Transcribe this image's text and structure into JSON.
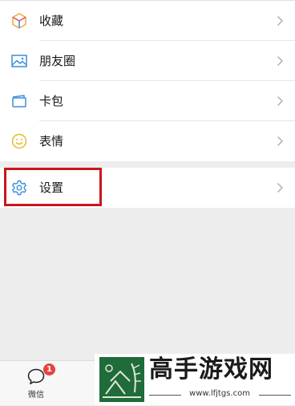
{
  "menu": {
    "items": [
      {
        "label": "收藏",
        "icon": "favorites-cube-icon"
      },
      {
        "label": "朋友圈",
        "icon": "moments-picture-icon"
      },
      {
        "label": "卡包",
        "icon": "card-wallet-icon"
      },
      {
        "label": "表情",
        "icon": "smiley-emoji-icon"
      }
    ],
    "settings": {
      "label": "设置",
      "icon": "settings-gear-icon"
    }
  },
  "tabbar": {
    "tabs": [
      {
        "label": "微信",
        "icon": "chat-bubble-icon",
        "badge": "1"
      }
    ]
  },
  "watermark": {
    "title": "高手游戏网",
    "url": "www.lfjtgs.com"
  },
  "colors": {
    "highlight": "#c8161d",
    "badge": "#e64340",
    "background": "#ededed"
  }
}
